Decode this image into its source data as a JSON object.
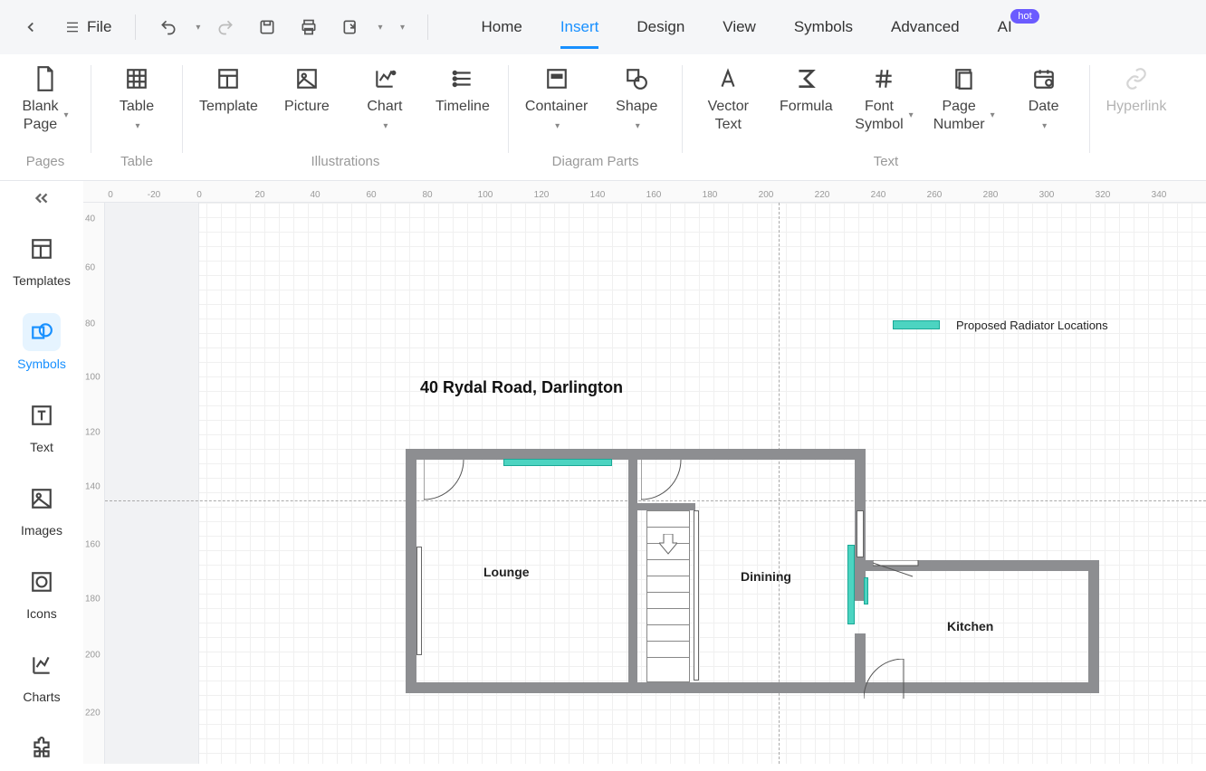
{
  "topbar": {
    "file_label": "File"
  },
  "menu": {
    "items": [
      "Home",
      "Insert",
      "Design",
      "View",
      "Symbols",
      "Advanced",
      "AI"
    ],
    "active": "Insert",
    "hot_badge": "hot"
  },
  "ribbon": {
    "groups": [
      {
        "label": "Pages",
        "items": [
          {
            "key": "blank-page",
            "label": "Blank\nPage",
            "caret": true
          }
        ]
      },
      {
        "label": "Table",
        "items": [
          {
            "key": "table",
            "label": "Table",
            "caret": true
          }
        ]
      },
      {
        "label": "Illustrations",
        "items": [
          {
            "key": "template",
            "label": "Template"
          },
          {
            "key": "picture",
            "label": "Picture"
          },
          {
            "key": "chart",
            "label": "Chart",
            "caret": true
          },
          {
            "key": "timeline",
            "label": "Timeline"
          }
        ]
      },
      {
        "label": "Diagram Parts",
        "items": [
          {
            "key": "container",
            "label": "Container",
            "caret": true
          },
          {
            "key": "shape",
            "label": "Shape",
            "caret": true
          }
        ]
      },
      {
        "label": "Text",
        "items": [
          {
            "key": "vector-text",
            "label": "Vector\nText"
          },
          {
            "key": "formula",
            "label": "Formula"
          },
          {
            "key": "font-symbol",
            "label": "Font\nSymbol",
            "caret": true
          },
          {
            "key": "page-number",
            "label": "Page\nNumber",
            "caret": true
          },
          {
            "key": "date",
            "label": "Date",
            "caret": true
          }
        ]
      },
      {
        "label": "",
        "items": [
          {
            "key": "hyperlink",
            "label": "Hyperlink",
            "disabled": true
          }
        ]
      }
    ]
  },
  "leftnav": {
    "items": [
      {
        "key": "templates",
        "label": "Templates"
      },
      {
        "key": "symbols",
        "label": "Symbols"
      },
      {
        "key": "text",
        "label": "Text"
      },
      {
        "key": "images",
        "label": "Images"
      },
      {
        "key": "icons",
        "label": "Icons"
      },
      {
        "key": "charts",
        "label": "Charts"
      }
    ],
    "active": "symbols"
  },
  "rulers": {
    "horizontal": [
      "0",
      "-20",
      "0",
      "20",
      "40",
      "60",
      "80",
      "100",
      "120",
      "140",
      "160",
      "180",
      "200",
      "220",
      "240",
      "260",
      "280",
      "300",
      "320",
      "340"
    ],
    "vertical": [
      "40",
      "60",
      "80",
      "100",
      "120",
      "140",
      "160",
      "180",
      "200",
      "220"
    ]
  },
  "diagram": {
    "title": "40 Rydal Road, Darlington",
    "legend": "Proposed Radiator Locations",
    "rooms": {
      "lounge": "Lounge",
      "dining": "Dinining",
      "kitchen": "Kitchen"
    }
  }
}
